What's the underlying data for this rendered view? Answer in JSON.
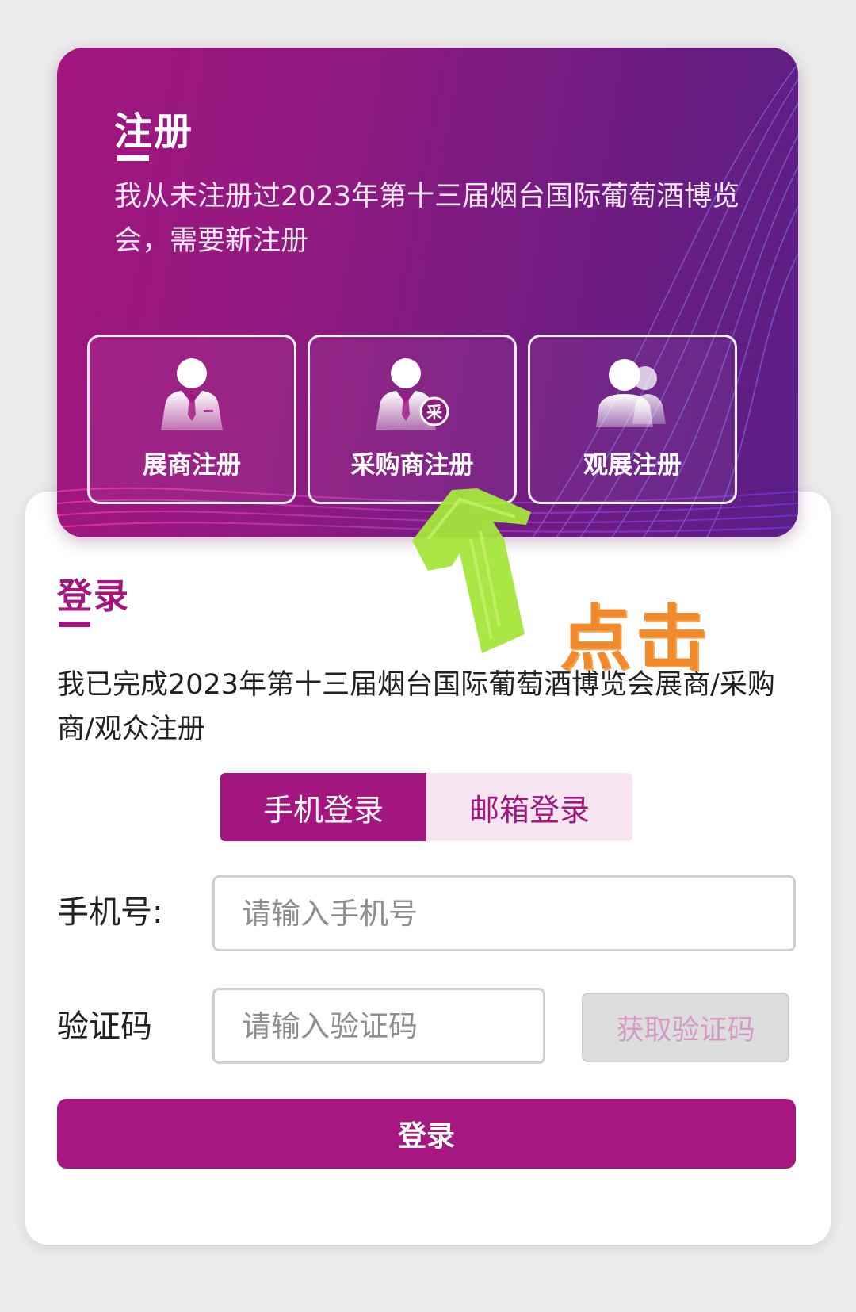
{
  "register": {
    "title": "注册",
    "description": "我从未注册过2023年第十三届烟台国际葡萄酒博览会，需要新注册",
    "buttons": [
      {
        "label": "展商注册",
        "icon": "exhibitor-person-icon"
      },
      {
        "label": "采购商注册",
        "icon": "buyer-person-icon"
      },
      {
        "label": "观展注册",
        "icon": "visitors-group-icon"
      }
    ],
    "buyer_badge": "采"
  },
  "login": {
    "title": "登录",
    "description": "我已完成2023年第十三届烟台国际葡萄酒博览会展商/采购商/观众注册",
    "tabs": [
      {
        "label": "手机登录",
        "active": true
      },
      {
        "label": "邮箱登录",
        "active": false
      }
    ],
    "phone": {
      "label": "手机号:",
      "placeholder": "请输入手机号",
      "value": ""
    },
    "code": {
      "label": "验证码",
      "placeholder": "请输入验证码",
      "value": ""
    },
    "get_code_label": "获取验证码",
    "submit_label": "登录"
  },
  "annotation": {
    "text": "点击",
    "arrow_color": "#a4e63a",
    "text_color": "#f08a2c"
  },
  "colors": {
    "brand": "#a3157f",
    "tab_inactive_bg": "#f7e5f1"
  }
}
